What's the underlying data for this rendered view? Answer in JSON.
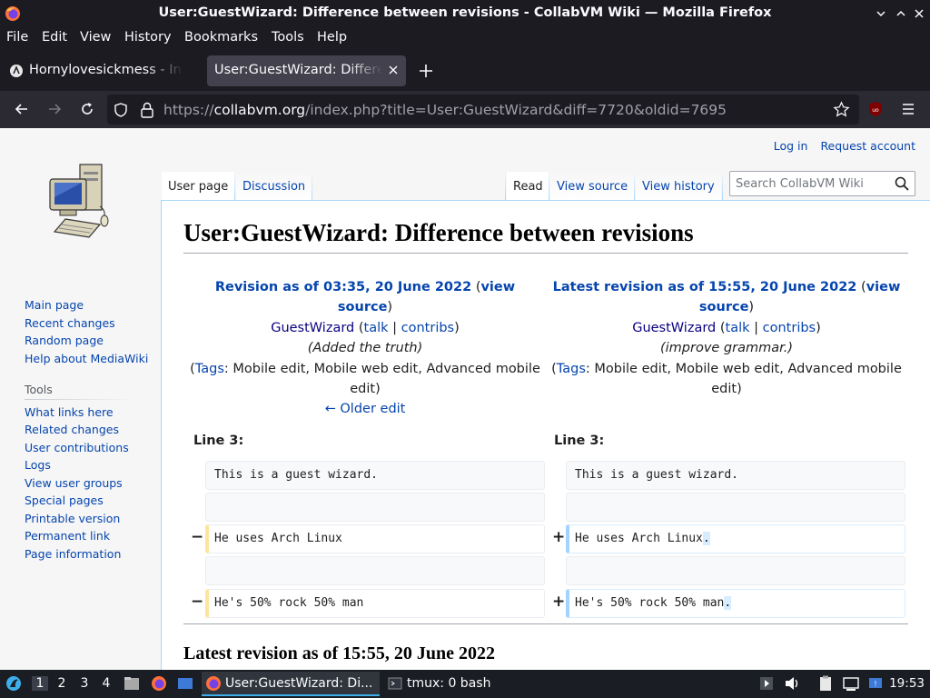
{
  "window": {
    "title": "User:GuestWizard: Difference between revisions - CollabVM Wiki — Mozilla Firefox"
  },
  "menu": [
    "File",
    "Edit",
    "View",
    "History",
    "Bookmarks",
    "Tools",
    "Help"
  ],
  "tabs": [
    {
      "label": "Hornylovesickmess - Inv",
      "active": false
    },
    {
      "label": "User:GuestWizard: Difference",
      "active": true
    }
  ],
  "url": {
    "prefix": "https://",
    "domain": "collabvm.org",
    "path": "/index.php?title=User:GuestWizard&diff=7720&oldid=7695"
  },
  "personal": {
    "login": "Log in",
    "request": "Request account"
  },
  "page_tabs": {
    "user_page": "User page",
    "discussion": "Discussion",
    "read": "Read",
    "view_source": "View source",
    "view_history": "View history"
  },
  "search": {
    "placeholder": "Search CollabVM Wiki"
  },
  "sidebar": {
    "nav": [
      "Main page",
      "Recent changes",
      "Random page",
      "Help about MediaWiki"
    ],
    "tools_heading": "Tools",
    "tools": [
      "What links here",
      "Related changes",
      "User contributions",
      "Logs",
      "View user groups",
      "Special pages",
      "Printable version",
      "Permanent link",
      "Page information"
    ]
  },
  "heading": "User:GuestWizard: Difference between revisions",
  "old_rev": {
    "title": "Revision as of 03:35, 20 June 2022",
    "view": "view",
    "source": "source",
    "user": "GuestWizard",
    "talk": "talk",
    "contribs": "contribs",
    "summary": "(Added the truth)",
    "tags_label": "Tags",
    "tags_line1": "Mobile edit, Mobile web edit, Advanced mobile",
    "tags_line2": "edit",
    "older_edit": "← Older edit"
  },
  "new_rev": {
    "title": "Latest revision as of 15:55, 20 June 2022",
    "view": "view",
    "source": "source",
    "user": "GuestWizard",
    "talk": "talk",
    "contribs": "contribs",
    "summary": "(improve grammar.)",
    "tags_label": "Tags",
    "tags_line1": "Mobile edit, Mobile web edit, Advanced mobile",
    "tags_line2": "edit"
  },
  "diff": {
    "line_label": "Line 3:",
    "row1": "This is a guest wizard.",
    "row3_old": "He uses Arch Linux",
    "row3_new": "He uses Arch Linux",
    "row3_new_ins": ".",
    "row5_old": "He's 50% rock 50% man",
    "row5_new": "He's 50% rock 50% man",
    "row5_new_ins": ".",
    "minus": "−",
    "plus": "+"
  },
  "subheading": "Latest revision as of 15:55, 20 June 2022",
  "taskbar": {
    "workspaces": [
      "1",
      "2",
      "3",
      "4"
    ],
    "task1": "User:GuestWizard: Di...",
    "task2": "tmux: 0 bash",
    "clock": "19:53"
  },
  "colors": {
    "link": "#0645ad",
    "deleted_border": "#ffe49c",
    "added_border": "#a3d3ff",
    "firefox_dark": "#1c1b22"
  }
}
